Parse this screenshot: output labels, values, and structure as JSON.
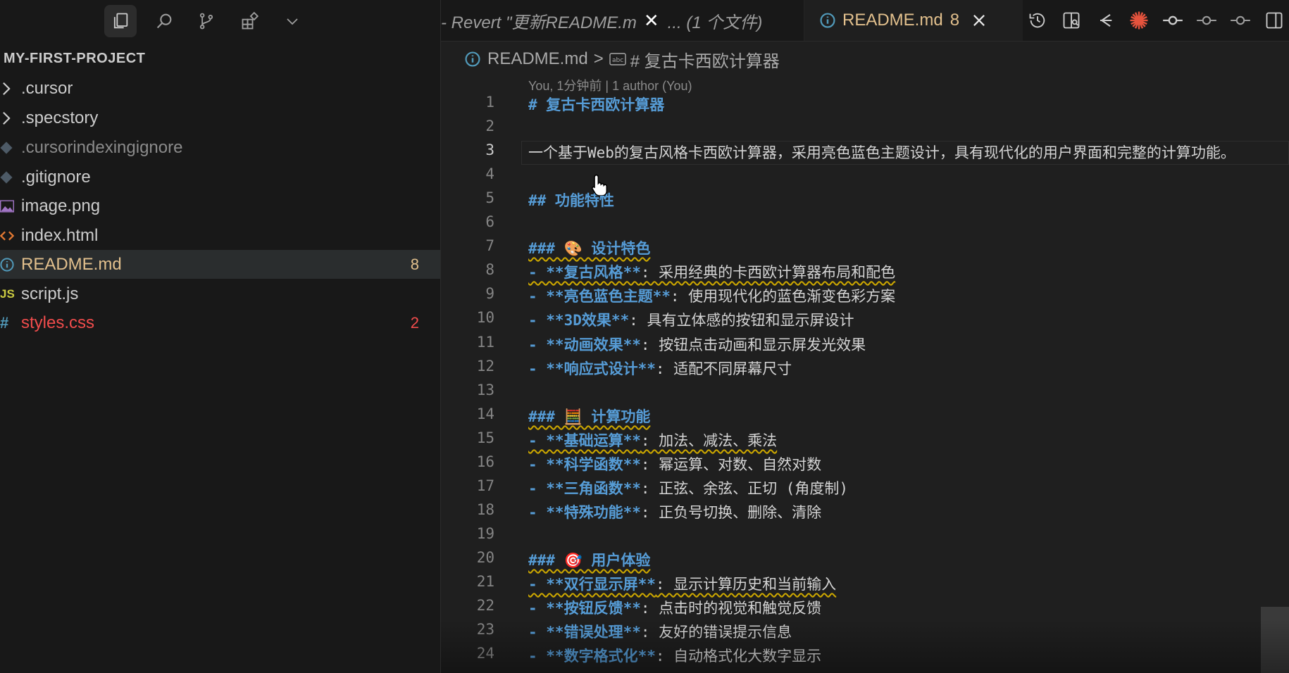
{
  "explorer": {
    "title": "MY-FIRST-PROJECT",
    "items": [
      {
        "label": ".cursor",
        "icon": "chevron-right-icon",
        "color": "#cccccc",
        "badge": ""
      },
      {
        "label": ".specstory",
        "icon": "chevron-right-icon",
        "color": "#cccccc",
        "badge": ""
      },
      {
        "label": ".cursorindexingignore",
        "icon": "ignore-file-icon",
        "color": "#8b8b8b",
        "badge": ""
      },
      {
        "label": ".gitignore",
        "icon": "git-file-icon",
        "color": "#cccccc",
        "badge": ""
      },
      {
        "label": "image.png",
        "icon": "image-file-icon",
        "color": "#cccccc",
        "badge": ""
      },
      {
        "label": "index.html",
        "icon": "html-file-icon",
        "color": "#cccccc",
        "badge": ""
      },
      {
        "label": "README.md",
        "icon": "info-file-icon",
        "color": "#e2c08d",
        "badge": "8",
        "selected": true
      },
      {
        "label": "script.js",
        "icon": "js-file-icon",
        "color": "#cccccc",
        "badge": ""
      },
      {
        "label": "styles.css",
        "icon": "css-file-icon",
        "color": "#f14c4c",
        "badge": "2"
      }
    ]
  },
  "tabs": {
    "inactive_label": "- Revert \"更新README.m",
    "inactive_suffix": "... (1 个文件)",
    "active_label": "README.md",
    "active_badge": "8"
  },
  "breadcrumb": {
    "file": "README.md",
    "separator": ">",
    "symbol": "# 复古卡西欧计算器"
  },
  "blame": "You, 1分钟前 | 1 author (You)",
  "lines": [
    {
      "n": "1",
      "parts": [
        {
          "c": "h",
          "t": "# 复古卡西欧计算器"
        }
      ]
    },
    {
      "n": "2",
      "parts": []
    },
    {
      "n": "3",
      "parts": [
        {
          "c": "t",
          "t": "一个基于Web的复古风格卡西欧计算器，采用亮色蓝色主题设计，具有现代化的用户界面和完整的计算功能。"
        }
      ]
    },
    {
      "n": "4",
      "parts": []
    },
    {
      "n": "5",
      "parts": [
        {
          "c": "h",
          "t": "## 功能特性"
        }
      ]
    },
    {
      "n": "6",
      "parts": []
    },
    {
      "n": "7",
      "parts": [
        {
          "c": "h wavy",
          "t": "### 🎨 设计特色"
        }
      ]
    },
    {
      "n": "8",
      "parts": [
        {
          "c": "b wavy",
          "t": "- **复古风格**"
        },
        {
          "c": "t wavy",
          "t": ": 采用经典的卡西欧计算器布局和配色"
        }
      ]
    },
    {
      "n": "9",
      "parts": [
        {
          "c": "b",
          "t": "- **亮色蓝色主题**"
        },
        {
          "c": "t",
          "t": ": 使用现代化的蓝色渐变色彩方案"
        }
      ]
    },
    {
      "n": "10",
      "parts": [
        {
          "c": "b",
          "t": "- **3D效果**"
        },
        {
          "c": "t",
          "t": ": 具有立体感的按钮和显示屏设计"
        }
      ]
    },
    {
      "n": "11",
      "parts": [
        {
          "c": "b",
          "t": "- **动画效果**"
        },
        {
          "c": "t",
          "t": ": 按钮点击动画和显示屏发光效果"
        }
      ]
    },
    {
      "n": "12",
      "parts": [
        {
          "c": "b",
          "t": "- **响应式设计**"
        },
        {
          "c": "t",
          "t": ": 适配不同屏幕尺寸"
        }
      ]
    },
    {
      "n": "13",
      "parts": []
    },
    {
      "n": "14",
      "parts": [
        {
          "c": "h wavy",
          "t": "### 🧮 计算功能"
        }
      ]
    },
    {
      "n": "15",
      "parts": [
        {
          "c": "b wavy",
          "t": "- **基础运算**"
        },
        {
          "c": "t wavy",
          "t": ": 加法、减法、乘法"
        }
      ]
    },
    {
      "n": "16",
      "parts": [
        {
          "c": "b",
          "t": "- **科学函数**"
        },
        {
          "c": "t",
          "t": ": 幂运算、对数、自然对数"
        }
      ]
    },
    {
      "n": "17",
      "parts": [
        {
          "c": "b",
          "t": "- **三角函数**"
        },
        {
          "c": "t",
          "t": ": 正弦、余弦、正切 (角度制)"
        }
      ]
    },
    {
      "n": "18",
      "parts": [
        {
          "c": "b",
          "t": "- **特殊功能**"
        },
        {
          "c": "t",
          "t": ": 正负号切换、删除、清除"
        }
      ]
    },
    {
      "n": "19",
      "parts": []
    },
    {
      "n": "20",
      "parts": [
        {
          "c": "h wavy",
          "t": "### 🎯 用户体验"
        }
      ]
    },
    {
      "n": "21",
      "parts": [
        {
          "c": "b wavy",
          "t": "- **双行显示屏**"
        },
        {
          "c": "t wavy",
          "t": ": 显示计算历史和当前输入"
        }
      ]
    },
    {
      "n": "22",
      "parts": [
        {
          "c": "b",
          "t": "- **按钮反馈**"
        },
        {
          "c": "t",
          "t": ": 点击时的视觉和触觉反馈"
        }
      ]
    },
    {
      "n": "23",
      "parts": [
        {
          "c": "b",
          "t": "- **错误处理**"
        },
        {
          "c": "t",
          "t": ": 友好的错误提示信息"
        }
      ]
    },
    {
      "n": "24",
      "parts": [
        {
          "c": "b",
          "t": "- **数字格式化**"
        },
        {
          "c": "t",
          "t": ": 自动格式化大数字显示"
        }
      ]
    }
  ],
  "colors": {
    "accent": "#e2c08d",
    "error": "#f14c4c",
    "keyword": "#569cd6",
    "warning_squiggle": "#cca700"
  }
}
